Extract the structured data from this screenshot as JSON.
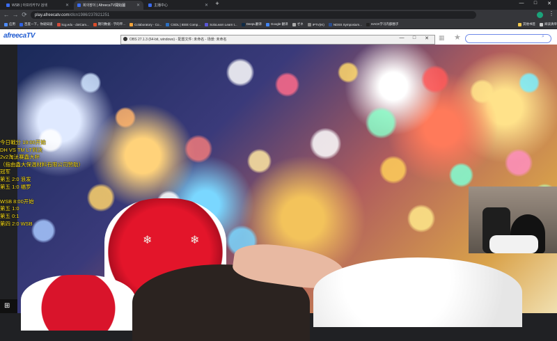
{
  "browser": {
    "tabs": [
      {
        "label": "WSB | 아프리카TV 검색",
        "favicon_color": "#3b6cf0"
      },
      {
        "label": "회의장이 | AfreecaTV開始圖",
        "favicon_color": "#3b6cf0",
        "active": true
      },
      {
        "label": "主播中心",
        "favicon_color": "#3b6cf0"
      }
    ],
    "new_tab": "+",
    "url_host": "play.afreecatv.com",
    "url_path": "/dlcn1986/237821251",
    "nav": {
      "back": "←",
      "forward": "→",
      "reload": "⟳"
    },
    "window_controls": {
      "minimize": "—",
      "maximize": "□",
      "close": "✕"
    },
    "bookmarks": [
      {
        "label": "应用",
        "color": "#4f8cf7"
      },
      {
        "label": "百度一下，你就知道",
        "color": "#2f62e3"
      },
      {
        "label": "kcg.edu - dotCam...",
        "color": "#d34c3c"
      },
      {
        "label": "期刊数据 - 学的平...",
        "color": "#d94c2a"
      },
      {
        "label": "Colaboratory - Co...",
        "color": "#f2a33a"
      },
      {
        "label": "CSDL | IEEE Comp...",
        "color": "#2b6fc2"
      },
      {
        "label": "SoloLearn Learn t...",
        "color": "#5a57d6"
      },
      {
        "label": "DeepL翻译",
        "color": "#0f2b46"
      },
      {
        "label": "Google 翻译",
        "color": "#4285f4"
      },
      {
        "label": "ゼネ",
        "color": "#aaaaaa"
      },
      {
        "label": "IPTV(IK)",
        "color": "#888888"
      },
      {
        "label": "NDSS Symposium...",
        "color": "#2a4d8f"
      },
      {
        "label": "HACK学习内部圈子",
        "color": "#222222"
      },
      {
        "label": "其他书签",
        "color": "#f2c94c"
      },
      {
        "label": "阅读清单",
        "color": "#cccccc"
      }
    ]
  },
  "site": {
    "logo": "afreecaTV"
  },
  "obs": {
    "title": "OBS 27.1.3 (64-bit, windows) - 配置文件: 未命名 - 场景: 未命名",
    "controls": {
      "minimize": "—",
      "maximize": "□",
      "close": "✕"
    }
  },
  "overlay": {
    "lines": [
      "今日戰分  19:00开始",
      "DH VS TM LT到決",
      "2v2淘汰赛鑫大杯",
      "（指由鑫大保温材料有限公司赞助）",
      "冠军",
      "第五 2:0 浪发",
      "第五 1:0 福罗",
      "",
      "WSB 8:00开始",
      "第五 1:0",
      "第五 0:1",
      "第四 2:0 WSB"
    ]
  },
  "taskbar": {
    "windows_icon": "⊞"
  },
  "colors": {
    "overlay_text": "#ffe21a",
    "accent": "#1f5bd1"
  }
}
